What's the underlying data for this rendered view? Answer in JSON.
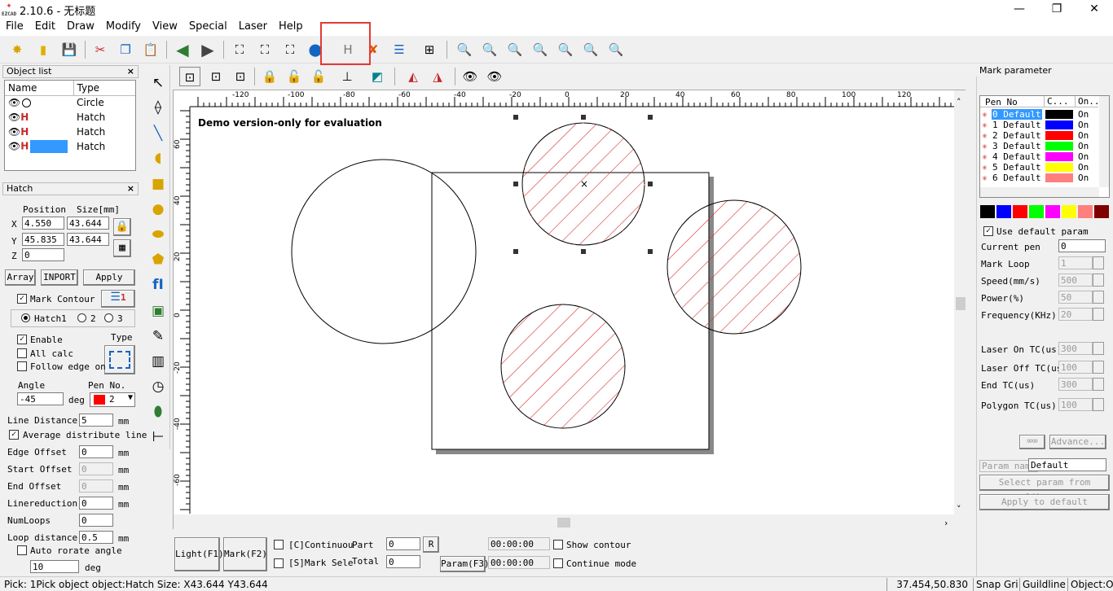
{
  "window": {
    "title": "2.10.6 - 无标题",
    "logo_text": "EZCAD",
    "min": "—",
    "max": "❐",
    "close": "✕"
  },
  "menu": [
    "File",
    "Edit",
    "Draw",
    "Modify",
    "View",
    "Special",
    "Laser",
    "Help"
  ],
  "toolbar1_icons": [
    "new-icon",
    "open-icon",
    "save-icon",
    "cut-icon",
    "copy-icon",
    "paste-icon",
    "back-icon",
    "forward-icon",
    "node-edit-icon",
    "node-edit2-icon",
    "select-all-icon",
    "color-icon",
    "hatch-icon",
    "magic-wand-icon",
    "list-icon",
    "align-icon",
    "zoom-icon",
    "zoom-in-icon",
    "zoom-plus-icon",
    "zoom-out-icon",
    "zoom-all-icon",
    "zoom-window-icon",
    "zoom-selected-icon"
  ],
  "object_list": {
    "title": "Object list",
    "close": "×",
    "headers": {
      "name": "Name",
      "type": "Type"
    },
    "rows": [
      {
        "type": "Circle"
      },
      {
        "type": "Hatch"
      },
      {
        "type": "Hatch"
      },
      {
        "type": "Hatch"
      }
    ]
  },
  "hatch_panel": {
    "title": "Hatch",
    "close": "×",
    "position_label": "Position",
    "size_label": "Size[mm]",
    "x_label": "X",
    "y_label": "Y",
    "z_label": "Z",
    "x_pos": "4.550",
    "x_size": "43.644",
    "y_pos": "45.835",
    "y_size": "43.644",
    "z_pos": "0",
    "array_btn": "Array",
    "inport_btn": "INPORT",
    "apply_btn": "Apply",
    "mark_contour": "Mark Contour",
    "contour_num": "1",
    "hatch1": "Hatch1",
    "hatch2": "2",
    "hatch3": "3",
    "enable": "Enable",
    "type_label": "Type",
    "all_calc": "All calc",
    "follow_edge": "Follow edge on",
    "angle_label": "Angle",
    "pen_no_label": "Pen No.",
    "angle": "-45",
    "deg": "deg",
    "pen_no": "2",
    "line_distance_label": "Line Distance",
    "line_distance": "5",
    "mm": "mm",
    "avg_distribute": "Average distribute line",
    "edge_offset_label": "Edge Offset",
    "edge_offset": "0",
    "start_offset_label": "Start Offset",
    "start_offset": "0",
    "end_offset_label": "End Offset",
    "end_offset": "0",
    "linereduction_label": "Linereduction",
    "linereduction": "0",
    "numloops_label": "NumLoops",
    "numloops": "0",
    "loop_distance_label": "Loop distance",
    "loop_distance": "0.5",
    "auto_rotate": "Auto rorate angle",
    "auto_rotate_val": "10",
    "auto_rotate_deg": "deg"
  },
  "canvas": {
    "demo_text": "Demo version-only for evaluation",
    "ruler_x": [
      "-120",
      "-100",
      "-80",
      "-60",
      "-40",
      "-20",
      "0",
      "20",
      "40",
      "60",
      "80",
      "100",
      "120"
    ],
    "ruler_y": [
      "60",
      "40",
      "20",
      "0",
      "-20",
      "-40",
      "-60"
    ]
  },
  "bottom": {
    "light": "Light(F1)",
    "mark": "Mark(F2)",
    "continuous": "[C]Continuou",
    "part_label": "Part",
    "part_val": "0",
    "r_btn": "R",
    "mark_sel": "[S]Mark Sele",
    "total_label": "Total",
    "total_val": "0",
    "param": "Param(F3)",
    "time1": "00:00:00",
    "time2": "00:00:00",
    "show_contour": "Show contour",
    "continue_mode": "Continue mode"
  },
  "mark_param": {
    "title": "Mark parameter",
    "headers": [
      "Pen No",
      "C...",
      "On..."
    ],
    "pens": [
      {
        "label": "0 Default",
        "color": "#000000",
        "on": "On"
      },
      {
        "label": "1 Default",
        "color": "#0000ff",
        "on": "On"
      },
      {
        "label": "2 Default",
        "color": "#ff0000",
        "on": "On"
      },
      {
        "label": "3 Default",
        "color": "#00ff00",
        "on": "On"
      },
      {
        "label": "4 Default",
        "color": "#ff00ff",
        "on": "On"
      },
      {
        "label": "5 Default",
        "color": "#ffff00",
        "on": "On"
      },
      {
        "label": "6 Default",
        "color": "#ff7f7f",
        "on": "On"
      }
    ],
    "palette": [
      "#000000",
      "#0000ff",
      "#ff0000",
      "#00ff00",
      "#ff00ff",
      "#ffff00",
      "#ff7f7f",
      "#800000"
    ],
    "use_default": "Use default param",
    "current_pen_label": "Current pen",
    "current_pen": "0",
    "mark_loop_label": "Mark Loop",
    "mark_loop": "1",
    "speed_label": "Speed(mm/s)",
    "speed": "500",
    "power_label": "Power(%)",
    "power": "50",
    "freq_label": "Frequency(KHz)",
    "freq": "20",
    "laser_on_label": "Laser On TC(us)",
    "laser_on": "300",
    "laser_off_label": "Laser Off TC(us",
    "laser_off": "100",
    "end_tc_label": "End TC(us)",
    "end_tc": "300",
    "polygon_tc_label": "Polygon TC(us)",
    "polygon_tc": "100",
    "advance": "Advance...",
    "param_name_label": "Param name",
    "param_name": "Default",
    "select_lib": "Select param from library",
    "apply_default": "Apply to default"
  },
  "status": {
    "pick": "Pick: 1Pick object object:Hatch Size: X43.644 Y43.644",
    "coords": "37.454,50.830",
    "snap": "Snap Grid",
    "guideline": "Guildline:",
    "object": "Object:O"
  }
}
